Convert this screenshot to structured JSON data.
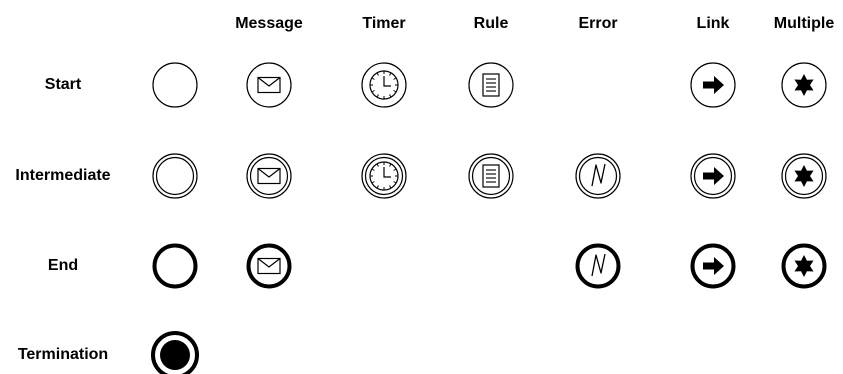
{
  "columns": [
    {
      "key": "none",
      "label": ""
    },
    {
      "key": "message",
      "label": "Message"
    },
    {
      "key": "timer",
      "label": "Timer"
    },
    {
      "key": "rule",
      "label": "Rule"
    },
    {
      "key": "error",
      "label": "Error"
    },
    {
      "key": "link",
      "label": "Link"
    },
    {
      "key": "multiple",
      "label": "Multiple"
    }
  ],
  "rows": [
    {
      "key": "start",
      "label": "Start",
      "kind": "start",
      "cells": [
        "none",
        "message",
        "timer",
        "rule",
        null,
        "link",
        "multiple"
      ]
    },
    {
      "key": "intermediate",
      "label": "Intermediate",
      "kind": "intermediate",
      "cells": [
        "none",
        "message",
        "timer",
        "rule",
        "error",
        "link",
        "multiple"
      ]
    },
    {
      "key": "end",
      "label": "End",
      "kind": "end",
      "cells": [
        "none",
        "message",
        null,
        null,
        "error",
        "link",
        "multiple"
      ]
    },
    {
      "key": "termination",
      "label": "Termination",
      "kind": "termination",
      "cells": [
        "none",
        null,
        null,
        null,
        null,
        null,
        null
      ]
    }
  ]
}
